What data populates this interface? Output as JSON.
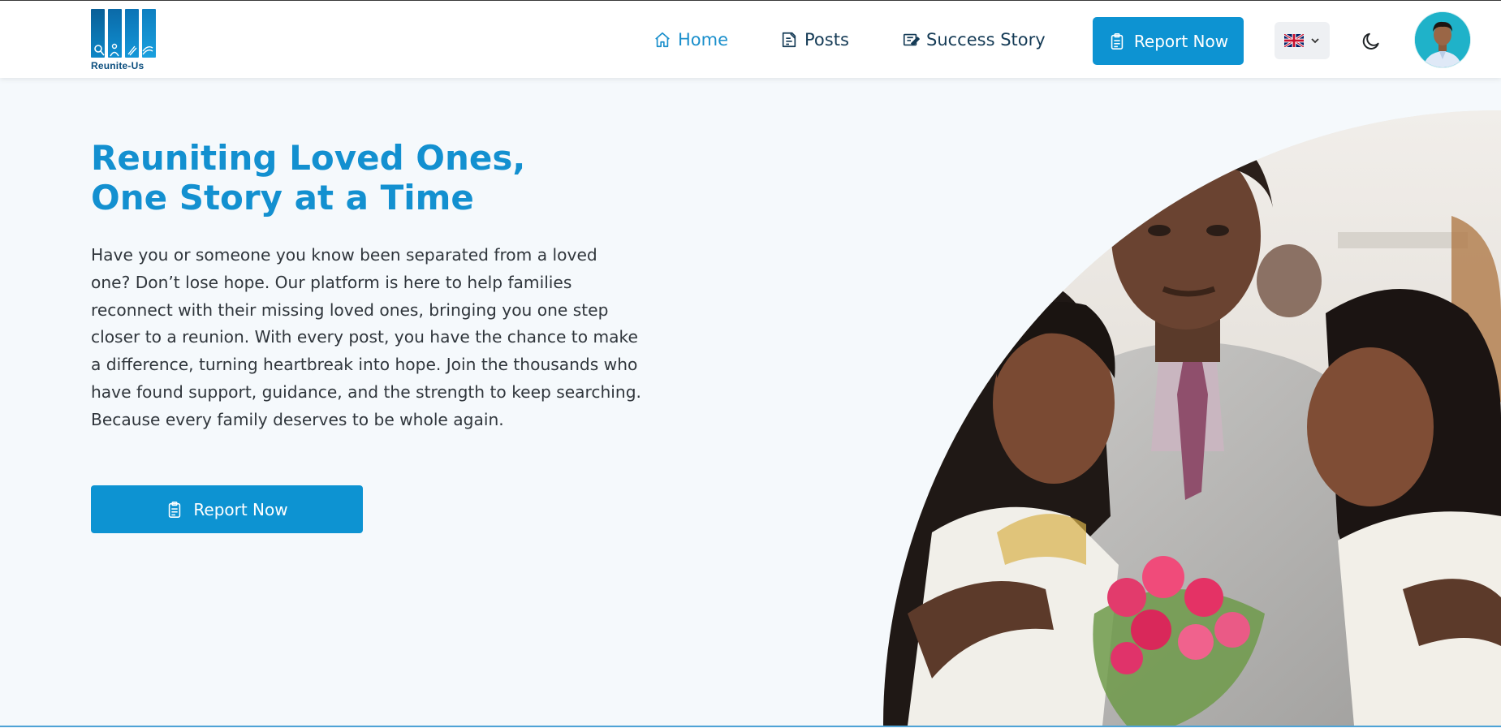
{
  "brand": {
    "name": "Reunite-Us",
    "color": "#0d93d2"
  },
  "nav": {
    "home_label": "Home",
    "posts_label": "Posts",
    "success_label": "Success Story",
    "report_label": "Report Now",
    "language_selected": "English (UK flag)",
    "theme_icon": "moon-icon"
  },
  "hero": {
    "title_line1": "Reuniting Loved Ones,",
    "title_line2": "One Story at a Time",
    "body": "Have you or someone you know been separated from a loved one? Don’t lose hope. Our platform is here to help families reconnect with their missing loved ones, bringing you one step closer to a reunion. With every post, you have the chance to make a difference, turning heartbreak into hope. Join the thousands who have found support, guidance, and the strength to keep searching. Because every family deserves to be whole again.",
    "cta_label": "Report Now"
  }
}
